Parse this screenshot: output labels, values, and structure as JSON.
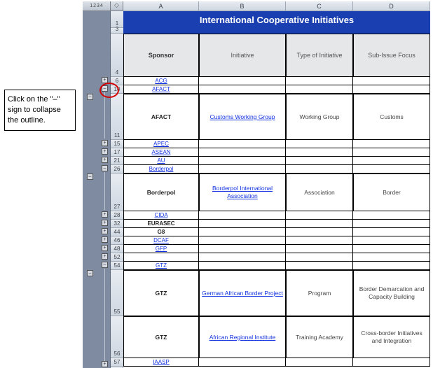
{
  "callout": {
    "text": "Click on the \"–\" sign to collapse the outline."
  },
  "outline": {
    "levels": [
      "1",
      "2",
      "3",
      "4"
    ]
  },
  "columns": {
    "A": "A",
    "B": "B",
    "C": "C",
    "D": "D"
  },
  "title": "International Cooperative Initiatives",
  "headers": {
    "sponsor": "Sponsor",
    "initiative": "Initiative",
    "type": "Type of Initiative",
    "sub_issue": "Sub-Issue Focus"
  },
  "row_numbers": {
    "r1": "1",
    "r3": "3",
    "r4": "4",
    "r6": "6",
    "r10": "10",
    "r11": "11",
    "r15": "15",
    "r17": "17",
    "r21": "21",
    "r26": "26",
    "r27": "27",
    "r28": "28",
    "r32": "32",
    "r44": "44",
    "r46": "46",
    "r48": "48",
    "r52": "52",
    "r54": "54",
    "r55": "55",
    "r56": "56",
    "r57": "57"
  },
  "rows": {
    "acg": {
      "sponsor": "ACG"
    },
    "afact1": {
      "sponsor": "AFACT"
    },
    "afact2": {
      "sponsor": "AFACT",
      "initiative": "Customs Working Group",
      "type": "Working Group",
      "sub_issue": "Customs"
    },
    "apec": {
      "sponsor": "APEC"
    },
    "asean": {
      "sponsor": "ASEAN"
    },
    "au": {
      "sponsor": "AU"
    },
    "borderpol1": {
      "sponsor": "Borderpol"
    },
    "borderpol2": {
      "sponsor": "Borderpol",
      "initiative": "Borderpol International Association",
      "type": "Association",
      "sub_issue": "Border"
    },
    "cida": {
      "sponsor": "CIDA"
    },
    "eurasec": {
      "sponsor": "EURASEC"
    },
    "g8": {
      "sponsor": "G8"
    },
    "dcaf": {
      "sponsor": "DCAF"
    },
    "gfp": {
      "sponsor": "GFP"
    },
    "gtz1": {
      "sponsor": "GTZ"
    },
    "gtz2": {
      "sponsor": "GTZ",
      "initiative": "German African Border Project",
      "type": "Program",
      "sub_issue": "Border Demarcation and Capacity Building"
    },
    "gtz3": {
      "sponsor": "GTZ",
      "initiative": "African Regional Institute",
      "type": "Training Academy",
      "sub_issue": "Cross-border Initiatives and Integration"
    },
    "iaasp": {
      "sponsor": "IAASP"
    }
  },
  "outline_controls": {
    "minus": "–",
    "plus": "+"
  }
}
